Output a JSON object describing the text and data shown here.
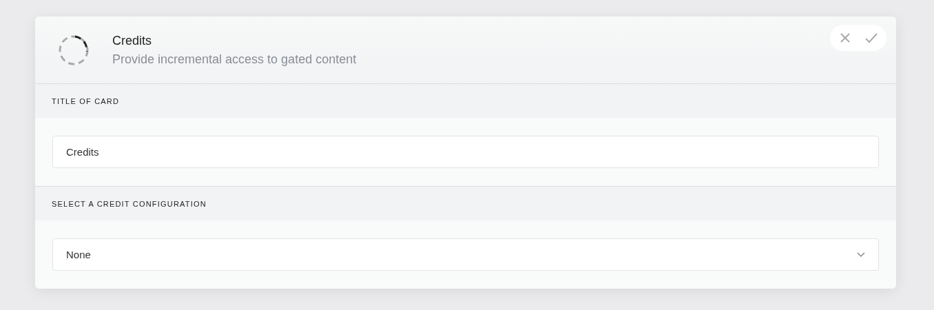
{
  "card": {
    "title": "Credits",
    "subtitle": "Provide incremental access to gated content"
  },
  "sections": [
    {
      "kind": "text",
      "label": "TITLE OF CARD",
      "value": "Credits"
    },
    {
      "kind": "select",
      "label": "SELECT A CREDIT CONFIGURATION",
      "value": "None"
    }
  ]
}
